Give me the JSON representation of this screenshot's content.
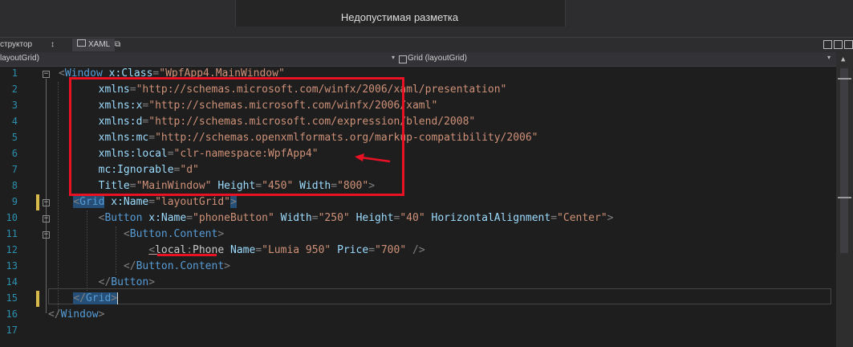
{
  "designer": {
    "status_text": "Недопустимая разметка"
  },
  "tabs": {
    "structure_label": "структор",
    "swap_icon": "↕",
    "xaml_label": "XAML",
    "popout_icon": "⧉"
  },
  "breadcrumbs": {
    "left": "layoutGrid)",
    "right": "Grid (layoutGrid)"
  },
  "gutter": {
    "line_numbers": [
      "1",
      "2",
      "3",
      "4",
      "5",
      "6",
      "7",
      "8",
      "9",
      "10",
      "11",
      "12",
      "13",
      "14",
      "15",
      "16",
      "17"
    ],
    "fold_minus": "−"
  },
  "code": {
    "l1": {
      "punct_open": "<",
      "element": "Window",
      "sp": " ",
      "attr": "x:Class",
      "eq": "=",
      "value": "\"WpfApp4.MainWindow\""
    },
    "l2": {
      "indent": "        ",
      "attr": "xmlns",
      "eq": "=",
      "value": "\"http://schemas.microsoft.com/winfx/2006/xaml/presentation\""
    },
    "l3": {
      "indent": "        ",
      "attr": "xmlns:x",
      "eq": "=",
      "value": "\"http://schemas.microsoft.com/winfx/2006/xaml\""
    },
    "l4": {
      "indent": "        ",
      "attr": "xmlns:d",
      "eq": "=",
      "value": "\"http://schemas.microsoft.com/expression/blend/2008\""
    },
    "l5": {
      "indent": "        ",
      "attr": "xmlns:mc",
      "eq": "=",
      "value": "\"http://schemas.openxmlformats.org/markup-compatibility/2006\""
    },
    "l6": {
      "indent": "        ",
      "attr": "xmlns:local",
      "eq": "=",
      "value": "\"clr-namespace:WpfApp4\""
    },
    "l7": {
      "indent": "        ",
      "attr": "mc:Ignorable",
      "eq": "=",
      "value": "\"d\""
    },
    "l8": {
      "indent": "        ",
      "attr1": "Title",
      "v1": "\"MainWindow\"",
      "attr2": "Height",
      "v2": "\"450\"",
      "attr3": "Width",
      "v3": "\"800\"",
      "eq": "=",
      "sp": " ",
      "close": ">"
    },
    "l9": {
      "indent": "    ",
      "open": "<",
      "element": "Grid",
      "sp": " ",
      "attr": "x:Name",
      "eq": "=",
      "value": "\"layoutGrid\"",
      "close": ">"
    },
    "l10": {
      "indent": "        ",
      "open": "<",
      "element": "Button",
      "sp": " ",
      "a1": "x:Name",
      "v1": "\"phoneButton\"",
      "a2": "Width",
      "v2": "\"250\"",
      "a3": "Height",
      "v3": "\"40\"",
      "a4": "HorizontalAlignment",
      "v4": "\"Center\"",
      "eq": "=",
      "close": ">"
    },
    "l11": {
      "indent": "            ",
      "open": "<",
      "element": "Button.Content",
      "close": ">"
    },
    "l12": {
      "indent": "                ",
      "open": "<",
      "prefix": "local",
      "colon": ":",
      "element": "Phone",
      "sp": " ",
      "a1": "Name",
      "v1": "\"Lumia 950\"",
      "a2": "Price",
      "v2": "\"700\"",
      "eq": "=",
      "close": " />"
    },
    "l13": {
      "indent": "            ",
      "open": "</",
      "element": "Button.Content",
      "close": ">"
    },
    "l14": {
      "indent": "        ",
      "open": "</",
      "element": "Button",
      "close": ">"
    },
    "l15": {
      "indent": "    ",
      "open": "</",
      "element": "Grid",
      "close": ">"
    },
    "l16": {
      "indent": "",
      "open": "</",
      "element": "Window",
      "close": ">"
    }
  },
  "colors": {
    "annotation": "#e81224",
    "element": "#569cd6",
    "attribute": "#9cdcfe",
    "value": "#ce9178",
    "line_number": "#2b91af",
    "change_marker": "#d7ba4a"
  }
}
